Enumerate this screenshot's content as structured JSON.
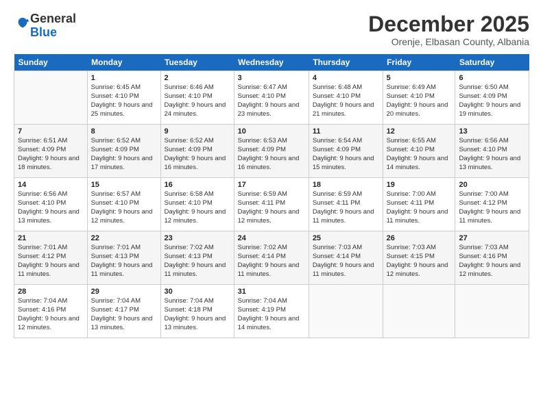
{
  "logo": {
    "general": "General",
    "blue": "Blue"
  },
  "title": "December 2025",
  "subtitle": "Orenje, Elbasan County, Albania",
  "days_header": [
    "Sunday",
    "Monday",
    "Tuesday",
    "Wednesday",
    "Thursday",
    "Friday",
    "Saturday"
  ],
  "weeks": [
    [
      {
        "day": "",
        "sunrise": "",
        "sunset": "",
        "daylight": ""
      },
      {
        "day": "1",
        "sunrise": "Sunrise: 6:45 AM",
        "sunset": "Sunset: 4:10 PM",
        "daylight": "Daylight: 9 hours and 25 minutes."
      },
      {
        "day": "2",
        "sunrise": "Sunrise: 6:46 AM",
        "sunset": "Sunset: 4:10 PM",
        "daylight": "Daylight: 9 hours and 24 minutes."
      },
      {
        "day": "3",
        "sunrise": "Sunrise: 6:47 AM",
        "sunset": "Sunset: 4:10 PM",
        "daylight": "Daylight: 9 hours and 23 minutes."
      },
      {
        "day": "4",
        "sunrise": "Sunrise: 6:48 AM",
        "sunset": "Sunset: 4:10 PM",
        "daylight": "Daylight: 9 hours and 21 minutes."
      },
      {
        "day": "5",
        "sunrise": "Sunrise: 6:49 AM",
        "sunset": "Sunset: 4:10 PM",
        "daylight": "Daylight: 9 hours and 20 minutes."
      },
      {
        "day": "6",
        "sunrise": "Sunrise: 6:50 AM",
        "sunset": "Sunset: 4:09 PM",
        "daylight": "Daylight: 9 hours and 19 minutes."
      }
    ],
    [
      {
        "day": "7",
        "sunrise": "Sunrise: 6:51 AM",
        "sunset": "Sunset: 4:09 PM",
        "daylight": "Daylight: 9 hours and 18 minutes."
      },
      {
        "day": "8",
        "sunrise": "Sunrise: 6:52 AM",
        "sunset": "Sunset: 4:09 PM",
        "daylight": "Daylight: 9 hours and 17 minutes."
      },
      {
        "day": "9",
        "sunrise": "Sunrise: 6:52 AM",
        "sunset": "Sunset: 4:09 PM",
        "daylight": "Daylight: 9 hours and 16 minutes."
      },
      {
        "day": "10",
        "sunrise": "Sunrise: 6:53 AM",
        "sunset": "Sunset: 4:09 PM",
        "daylight": "Daylight: 9 hours and 16 minutes."
      },
      {
        "day": "11",
        "sunrise": "Sunrise: 6:54 AM",
        "sunset": "Sunset: 4:09 PM",
        "daylight": "Daylight: 9 hours and 15 minutes."
      },
      {
        "day": "12",
        "sunrise": "Sunrise: 6:55 AM",
        "sunset": "Sunset: 4:10 PM",
        "daylight": "Daylight: 9 hours and 14 minutes."
      },
      {
        "day": "13",
        "sunrise": "Sunrise: 6:56 AM",
        "sunset": "Sunset: 4:10 PM",
        "daylight": "Daylight: 9 hours and 13 minutes."
      }
    ],
    [
      {
        "day": "14",
        "sunrise": "Sunrise: 6:56 AM",
        "sunset": "Sunset: 4:10 PM",
        "daylight": "Daylight: 9 hours and 13 minutes."
      },
      {
        "day": "15",
        "sunrise": "Sunrise: 6:57 AM",
        "sunset": "Sunset: 4:10 PM",
        "daylight": "Daylight: 9 hours and 12 minutes."
      },
      {
        "day": "16",
        "sunrise": "Sunrise: 6:58 AM",
        "sunset": "Sunset: 4:10 PM",
        "daylight": "Daylight: 9 hours and 12 minutes."
      },
      {
        "day": "17",
        "sunrise": "Sunrise: 6:59 AM",
        "sunset": "Sunset: 4:11 PM",
        "daylight": "Daylight: 9 hours and 12 minutes."
      },
      {
        "day": "18",
        "sunrise": "Sunrise: 6:59 AM",
        "sunset": "Sunset: 4:11 PM",
        "daylight": "Daylight: 9 hours and 11 minutes."
      },
      {
        "day": "19",
        "sunrise": "Sunrise: 7:00 AM",
        "sunset": "Sunset: 4:11 PM",
        "daylight": "Daylight: 9 hours and 11 minutes."
      },
      {
        "day": "20",
        "sunrise": "Sunrise: 7:00 AM",
        "sunset": "Sunset: 4:12 PM",
        "daylight": "Daylight: 9 hours and 11 minutes."
      }
    ],
    [
      {
        "day": "21",
        "sunrise": "Sunrise: 7:01 AM",
        "sunset": "Sunset: 4:12 PM",
        "daylight": "Daylight: 9 hours and 11 minutes."
      },
      {
        "day": "22",
        "sunrise": "Sunrise: 7:01 AM",
        "sunset": "Sunset: 4:13 PM",
        "daylight": "Daylight: 9 hours and 11 minutes."
      },
      {
        "day": "23",
        "sunrise": "Sunrise: 7:02 AM",
        "sunset": "Sunset: 4:13 PM",
        "daylight": "Daylight: 9 hours and 11 minutes."
      },
      {
        "day": "24",
        "sunrise": "Sunrise: 7:02 AM",
        "sunset": "Sunset: 4:14 PM",
        "daylight": "Daylight: 9 hours and 11 minutes."
      },
      {
        "day": "25",
        "sunrise": "Sunrise: 7:03 AM",
        "sunset": "Sunset: 4:14 PM",
        "daylight": "Daylight: 9 hours and 11 minutes."
      },
      {
        "day": "26",
        "sunrise": "Sunrise: 7:03 AM",
        "sunset": "Sunset: 4:15 PM",
        "daylight": "Daylight: 9 hours and 12 minutes."
      },
      {
        "day": "27",
        "sunrise": "Sunrise: 7:03 AM",
        "sunset": "Sunset: 4:16 PM",
        "daylight": "Daylight: 9 hours and 12 minutes."
      }
    ],
    [
      {
        "day": "28",
        "sunrise": "Sunrise: 7:04 AM",
        "sunset": "Sunset: 4:16 PM",
        "daylight": "Daylight: 9 hours and 12 minutes."
      },
      {
        "day": "29",
        "sunrise": "Sunrise: 7:04 AM",
        "sunset": "Sunset: 4:17 PM",
        "daylight": "Daylight: 9 hours and 13 minutes."
      },
      {
        "day": "30",
        "sunrise": "Sunrise: 7:04 AM",
        "sunset": "Sunset: 4:18 PM",
        "daylight": "Daylight: 9 hours and 13 minutes."
      },
      {
        "day": "31",
        "sunrise": "Sunrise: 7:04 AM",
        "sunset": "Sunset: 4:19 PM",
        "daylight": "Daylight: 9 hours and 14 minutes."
      },
      {
        "day": "",
        "sunrise": "",
        "sunset": "",
        "daylight": ""
      },
      {
        "day": "",
        "sunrise": "",
        "sunset": "",
        "daylight": ""
      },
      {
        "day": "",
        "sunrise": "",
        "sunset": "",
        "daylight": ""
      }
    ]
  ]
}
